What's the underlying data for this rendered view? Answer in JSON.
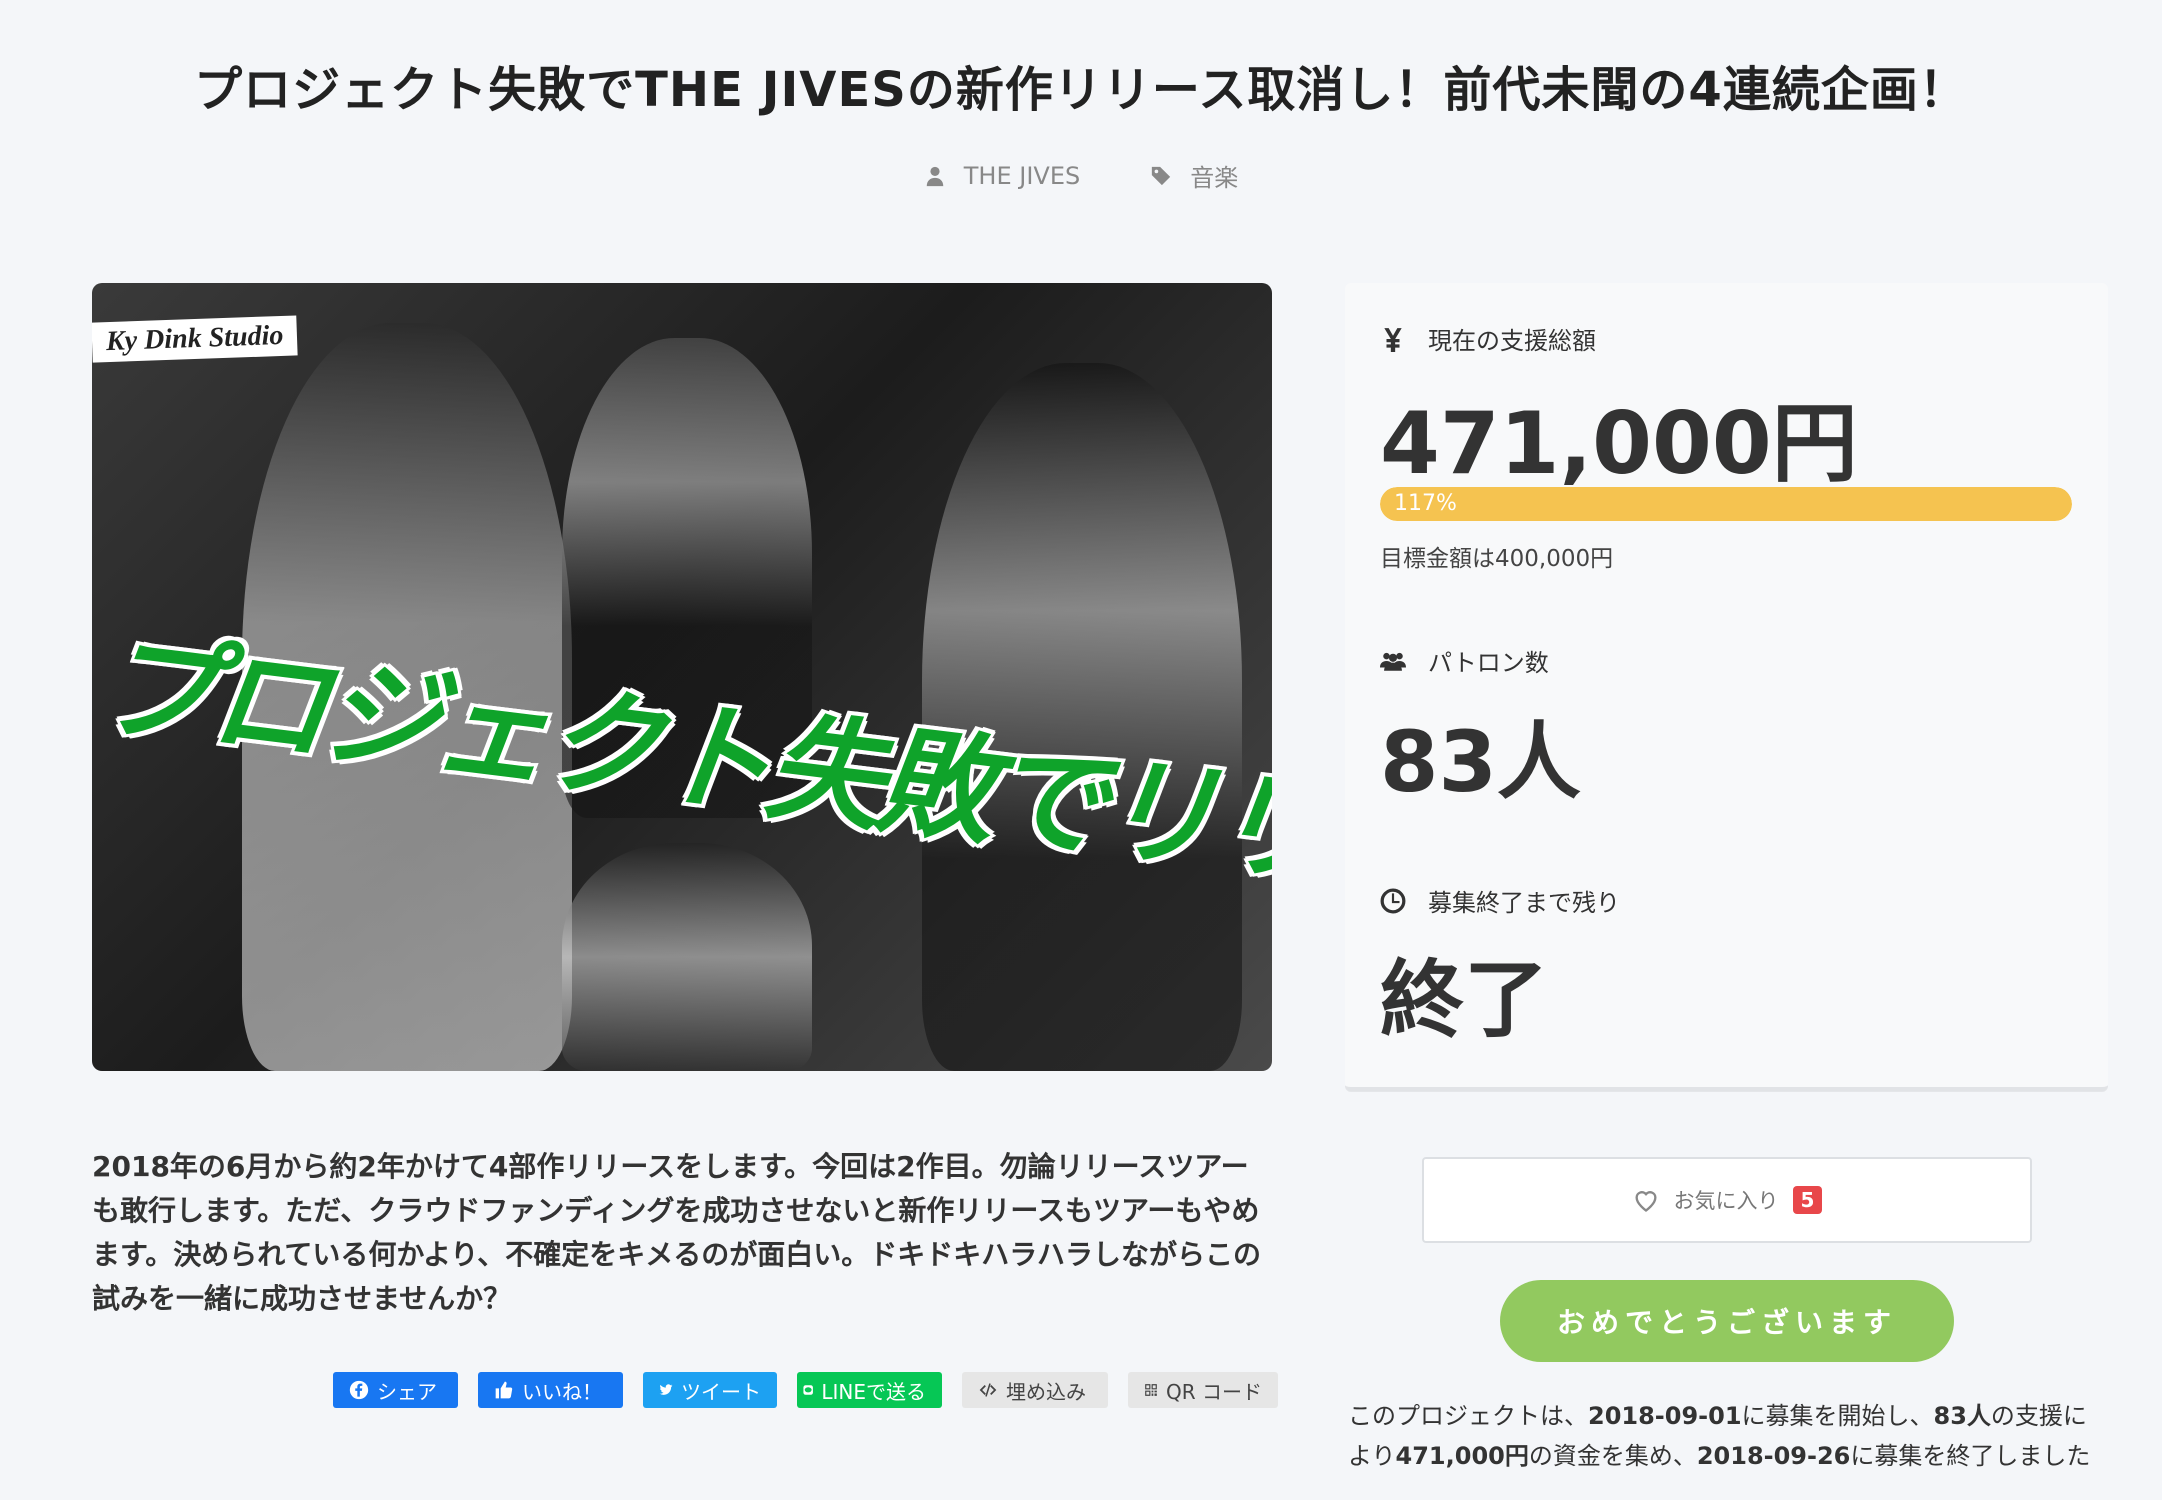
{
  "project": {
    "title": "プロジェクト失敗でTHE JIVESの新作リリース取消し！前代未聞の4連続企画！",
    "owner": "THE JIVES",
    "category": "音楽"
  },
  "hero": {
    "overlay_text": "プロジェクト失敗でリリース取消！",
    "sign_text": "Ky Dink Studio"
  },
  "stats": {
    "total_label": "現在の支援総額",
    "total_value": "471,000円",
    "progress_percent": 117,
    "progress_label": "117%",
    "goal_text": "目標金額は400,000円",
    "patrons_label": "パトロン数",
    "patrons_value": "83人",
    "remaining_label": "募集終了まで残り",
    "remaining_value": "終了"
  },
  "actions": {
    "favorite_label": "お気に入り",
    "favorite_count": "5",
    "congrats_label": "おめでとうございます"
  },
  "summary": {
    "p1": "このプロジェクトは、",
    "start_date": "2018-09-01",
    "p2": "に募集を開始し、",
    "patrons": "83人",
    "p3": "の支援により",
    "amount": "471,000円",
    "p4": "の資金を集め、",
    "end_date": "2018-09-26",
    "p5": "に募集を終了しました"
  },
  "description": "2018年の6月から約2年かけて4部作リリースをします。今回は2作目。勿論リリースツアーも敢行します。ただ、クラウドファンディングを成功させないと新作リリースもツアーもやめます。決められている何かより、不確定をキメるのが面白い。ドキドキハラハラしながらこの試みを一緒に成功させませんか？",
  "share": {
    "facebook": "シェア",
    "like": "いいね！",
    "tweet": "ツイート",
    "line": "LINEで送る",
    "embed": "埋め込み",
    "qr": "QR コード"
  },
  "colors": {
    "accent_green": "#92c95f",
    "progress_yellow": "#f5c350",
    "badge_red": "#e8474a",
    "overlay_green": "#0fa32a"
  }
}
